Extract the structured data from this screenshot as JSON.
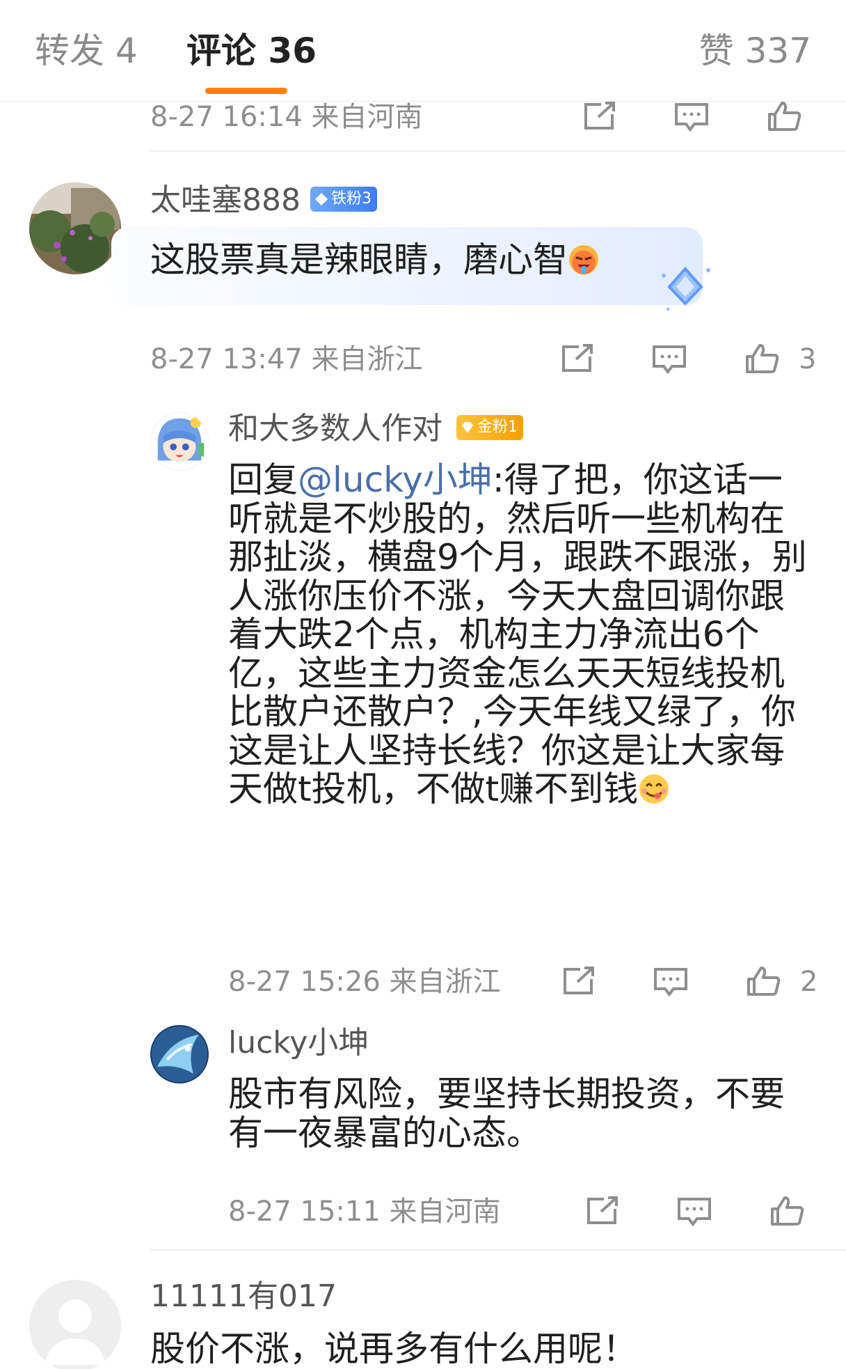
{
  "tabs": {
    "forward": "转发 4",
    "comments": "评论 36",
    "likes": "赞 337"
  },
  "colors": {
    "accent": "#ff8200",
    "mention": "#4b6ea8",
    "iron_badge": "#3d7cf0",
    "gold_badge": "#f5a000"
  },
  "partial_comment": {
    "meta": "8-27 16:14  来自河南"
  },
  "comment1": {
    "username": "太哇塞888",
    "badge": "铁粉3",
    "text": "这股票真是辣眼睛，磨心智",
    "emoji": "hot-face-emoji",
    "meta": "8-27 13:47  来自浙江",
    "likes": "3"
  },
  "reply1": {
    "username": "和大多数人作对",
    "badge": "金粉1",
    "prefix": "回复",
    "mention": "@lucky小坤",
    "text": ":得了把，你这话一听就是不炒股的，然后听一些机构在那扯淡，横盘9个月，跟跌不跟涨，别人涨你压价不涨，今天大盘回调你跟着大跌2个点，机构主力净流出6个亿，这些主力资金怎么天天短线投机比散户还散户？,今天年线又绿了，你这是让人坚持长线？你这是让大家每天做t投机，不做t赚不到钱",
    "emoji": "yummy-face-emoji",
    "meta": "8-27 15:26  来自浙江",
    "likes": "2"
  },
  "reply2": {
    "username": "lucky小坤",
    "text": "股市有风险，要坚持长期投资，不要有一夜暴富的心态。",
    "meta": "8-27 15:11  来自河南"
  },
  "comment2": {
    "username": "11111有017",
    "text": "股价不涨，说再多有什么用呢！"
  }
}
